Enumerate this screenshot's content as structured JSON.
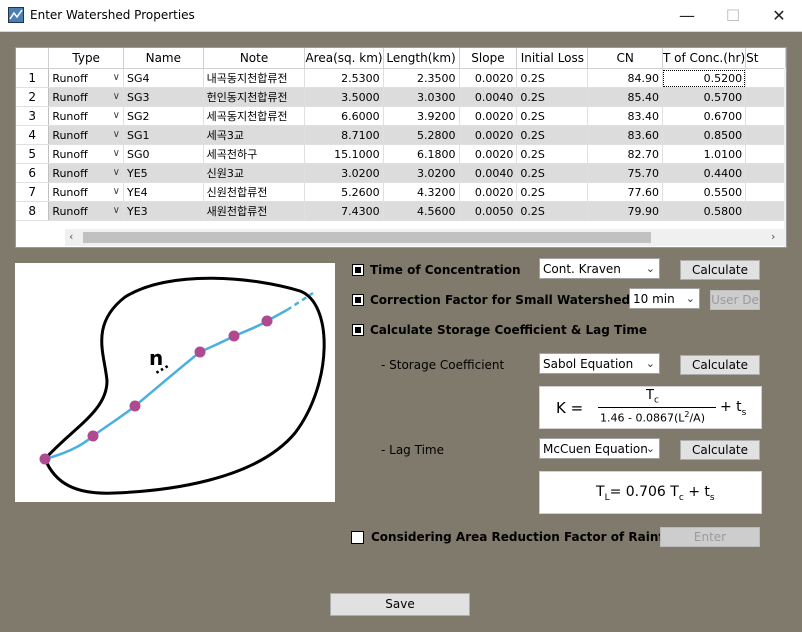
{
  "window": {
    "title": "Enter Watershed Properties"
  },
  "grid": {
    "columns": [
      "Type",
      "Name",
      "Note",
      "Area(sq. km)",
      "Length(km)",
      "Slope",
      "Initial Loss",
      "CN",
      "T of Conc.(hr)",
      "St"
    ],
    "rows": [
      {
        "num": "1",
        "type": "Runoff",
        "name": "SG4",
        "note": "내곡동지천합류전",
        "area": "2.5300",
        "length": "2.3500",
        "slope": "0.0020",
        "loss": "0.2S",
        "cn": "84.90",
        "tc": "0.5200"
      },
      {
        "num": "2",
        "type": "Runoff",
        "name": "SG3",
        "note": "헌인동지천합류전",
        "area": "3.5000",
        "length": "3.0300",
        "slope": "0.0040",
        "loss": "0.2S",
        "cn": "85.40",
        "tc": "0.5700"
      },
      {
        "num": "3",
        "type": "Runoff",
        "name": "SG2",
        "note": "세곡동지천합류전",
        "area": "6.6000",
        "length": "3.9200",
        "slope": "0.0020",
        "loss": "0.2S",
        "cn": "83.40",
        "tc": "0.6700"
      },
      {
        "num": "4",
        "type": "Runoff",
        "name": "SG1",
        "note": "세곡3교",
        "area": "8.7100",
        "length": "5.2800",
        "slope": "0.0020",
        "loss": "0.2S",
        "cn": "83.60",
        "tc": "0.8500"
      },
      {
        "num": "5",
        "type": "Runoff",
        "name": "SG0",
        "note": "세곡천하구",
        "area": "15.1000",
        "length": "6.1800",
        "slope": "0.0020",
        "loss": "0.2S",
        "cn": "82.70",
        "tc": "1.0100"
      },
      {
        "num": "6",
        "type": "Runoff",
        "name": "YE5",
        "note": "신원3교",
        "area": "3.0200",
        "length": "3.0200",
        "slope": "0.0040",
        "loss": "0.2S",
        "cn": "75.70",
        "tc": "0.4400"
      },
      {
        "num": "7",
        "type": "Runoff",
        "name": "YE4",
        "note": "신원천합류전",
        "area": "5.2600",
        "length": "4.3200",
        "slope": "0.0020",
        "loss": "0.2S",
        "cn": "77.60",
        "tc": "0.5500"
      },
      {
        "num": "8",
        "type": "Runoff",
        "name": "YE3",
        "note": "새원천합류전",
        "area": "7.4300",
        "length": "4.5600",
        "slope": "0.0050",
        "loss": "0.2S",
        "cn": "79.90",
        "tc": "0.5800"
      }
    ]
  },
  "diagram": {
    "label": "n"
  },
  "toc": {
    "label": "Time of Concentration",
    "method": "Cont. Kraven",
    "button": "Calculate"
  },
  "correction": {
    "label": "Correction Factor for Small Watershed (ts)",
    "value": "10 min",
    "button": "User De"
  },
  "storage_section": {
    "label": "Calculate Storage Coefficient & Lag Time"
  },
  "storage": {
    "label": "- Storage Coefficient",
    "method": "Sabol Equation",
    "button": "Calculate",
    "formula_lhs": "K =",
    "numerator": "T",
    "numerator_sub": "c",
    "denominator_a": "1.46 - 0.0867(L",
    "denominator_sup": "2",
    "denominator_b": "/A)",
    "tail": "+ t",
    "tail_sub": "s"
  },
  "lag": {
    "label": "- Lag Time",
    "method": "McCuen Equation",
    "button": "Calculate",
    "f_t": "T",
    "f_l": "L",
    "f_rest": "= 0.706 T",
    "f_c": "c",
    "f_plus": "+ t",
    "f_s": "s"
  },
  "area_reduction": {
    "label": "Considering Area Reduction Factor of Rainfall",
    "button": "Enter"
  },
  "footer": {
    "save": "Save"
  }
}
